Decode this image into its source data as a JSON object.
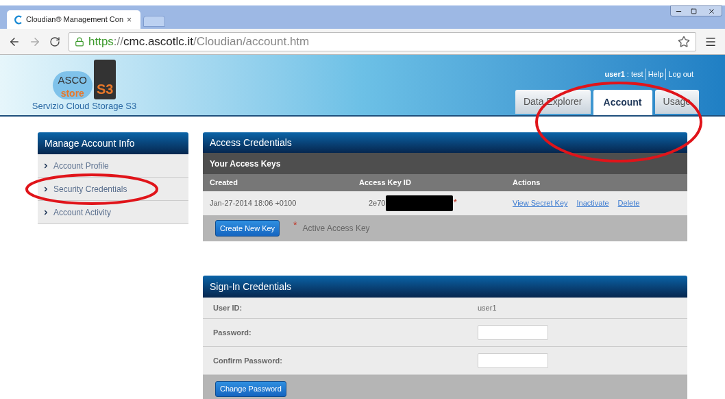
{
  "browser": {
    "tab_title": "Cloudian® Management Con",
    "tab_close": "×",
    "url_scheme": "https",
    "url_sep": "://",
    "url_host": "cmc.ascotlc.it",
    "url_path": "/Cloudian/account.htm"
  },
  "header": {
    "logo_text": "ASCO",
    "logo_sub": "store",
    "logo_badge": "S3",
    "subtitle": "Servizio Cloud Storage S3",
    "user": "user1",
    "user_role": " : test",
    "links": [
      "Help",
      "Log out"
    ],
    "tabs": [
      {
        "label": "Data Explorer",
        "selected": false
      },
      {
        "label": "Account",
        "selected": true
      },
      {
        "label": "Usage",
        "selected": false
      }
    ]
  },
  "sidebar": {
    "title": "Manage Account Info",
    "items": [
      "Account Profile",
      "Security Credentials",
      "Account Activity"
    ]
  },
  "access": {
    "title": "Access Credentials",
    "subtitle": "Your Access Keys",
    "columns": [
      "Created",
      "Access Key ID",
      "Actions"
    ],
    "rows": [
      {
        "created": "Jan-27-2014 18:06 +0100",
        "key_id": "2e70",
        "redacted": true,
        "mark": "*",
        "actions": [
          "View Secret Key",
          "Inactivate",
          "Delete"
        ]
      }
    ],
    "create_button": "Create New Key",
    "legend_mark": "*",
    "legend": "Active Access Key"
  },
  "signin": {
    "title": "Sign-In Credentials",
    "rows": [
      {
        "kind": "text",
        "label": "User ID:",
        "value": "user1"
      },
      {
        "kind": "input",
        "label": "Password:"
      },
      {
        "kind": "input",
        "label": "Confirm Password:"
      }
    ],
    "button": "Change Password"
  }
}
